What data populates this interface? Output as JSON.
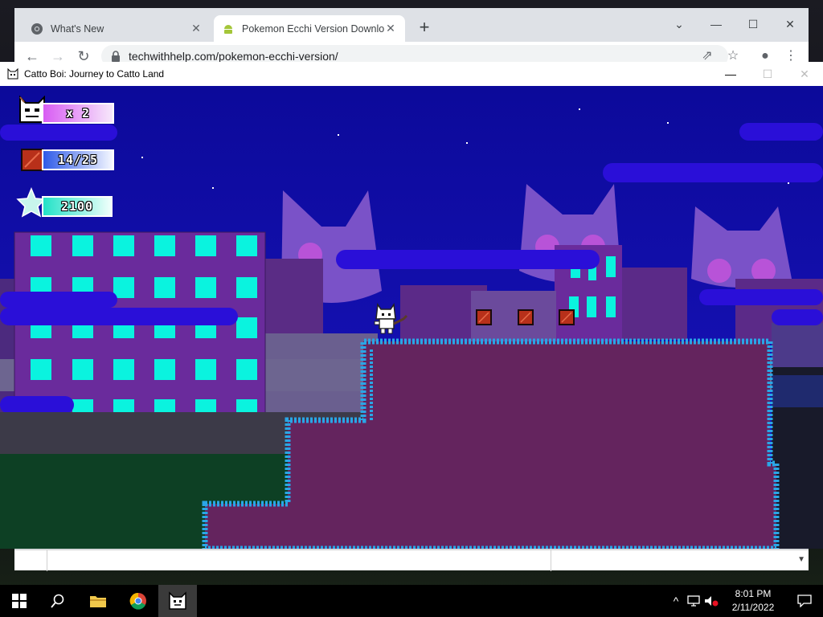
{
  "browser": {
    "tabs": [
      {
        "title": "What's New",
        "icon": "chrome-icon",
        "active": false
      },
      {
        "title": "Pokemon Ecchi Version Downloa",
        "icon": "android-icon",
        "active": true
      }
    ],
    "url": "techwithhelp.com/pokemon-ecchi-version/"
  },
  "game_window": {
    "title": "Catto Boi: Journey to Catto Land",
    "hud": {
      "lives": "x 2",
      "boxes": "14/25",
      "score": "2100"
    }
  },
  "taskbar": {
    "clock_time": "8:01 PM",
    "clock_date": "2/11/2022",
    "pinned": [
      "start-button",
      "search-button",
      "file-explorer",
      "chrome",
      "catto-boi-game"
    ]
  },
  "colors": {
    "sky": "#0f0aa8",
    "platform_fill": "#64245e",
    "platform_edge": "#2aa6e6",
    "building_purple": "#6a2b9c",
    "window_cyan": "#0af3df",
    "crate_red": "#b8301a"
  }
}
